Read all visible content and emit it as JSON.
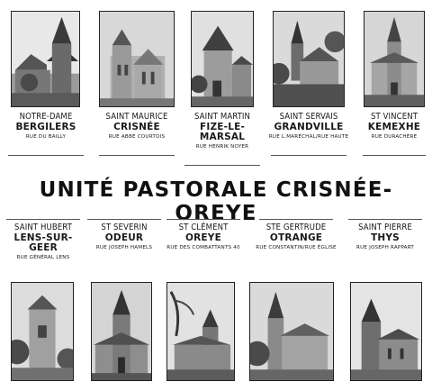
{
  "title": "UNITÉ PASTORALE CRISNÉE-OREYE",
  "top_row": [
    {
      "saint": "NOTRE-DAME",
      "place": "BERGILERS",
      "street": "RUE DU BAILLY"
    },
    {
      "saint": "SAINT MAURICE",
      "place": "CRISNÉE",
      "street": "RUE ABBÉ COURTOIS"
    },
    {
      "saint": "SAINT MARTIN",
      "place": "FIZE-LE-MARSAL",
      "street": "RUE HENRIK NOYER"
    },
    {
      "saint": "SAINT SERVAIS",
      "place": "GRANDVILLE",
      "street": "RUE L.MARÉCHAL/RUE HAUTE"
    },
    {
      "saint": "ST VINCENT",
      "place": "KEMEXHE",
      "street": "RUE DURACHÈRE"
    }
  ],
  "bottom_row": [
    {
      "saint": "SAINT HUBERT",
      "place": "LENS-SUR-GEER",
      "street": "RUE GÉNÉRAL LENS"
    },
    {
      "saint": "ST SEVERIN",
      "place": "ODEUR",
      "street": "RUE JOSEPH HAMELS"
    },
    {
      "saint": "ST CLÉMENT",
      "place": "OREYE",
      "street": "RUE DES COMBATTANTS 40"
    },
    {
      "saint": "STE GERTRUDE",
      "place": "OTRANGE",
      "street": "RUE CONSTANTIN/RUE ÉGLISE"
    },
    {
      "saint": "SAINT PIERRE",
      "place": "THYS",
      "street": "RUE JOSEPH RAPPART"
    }
  ]
}
